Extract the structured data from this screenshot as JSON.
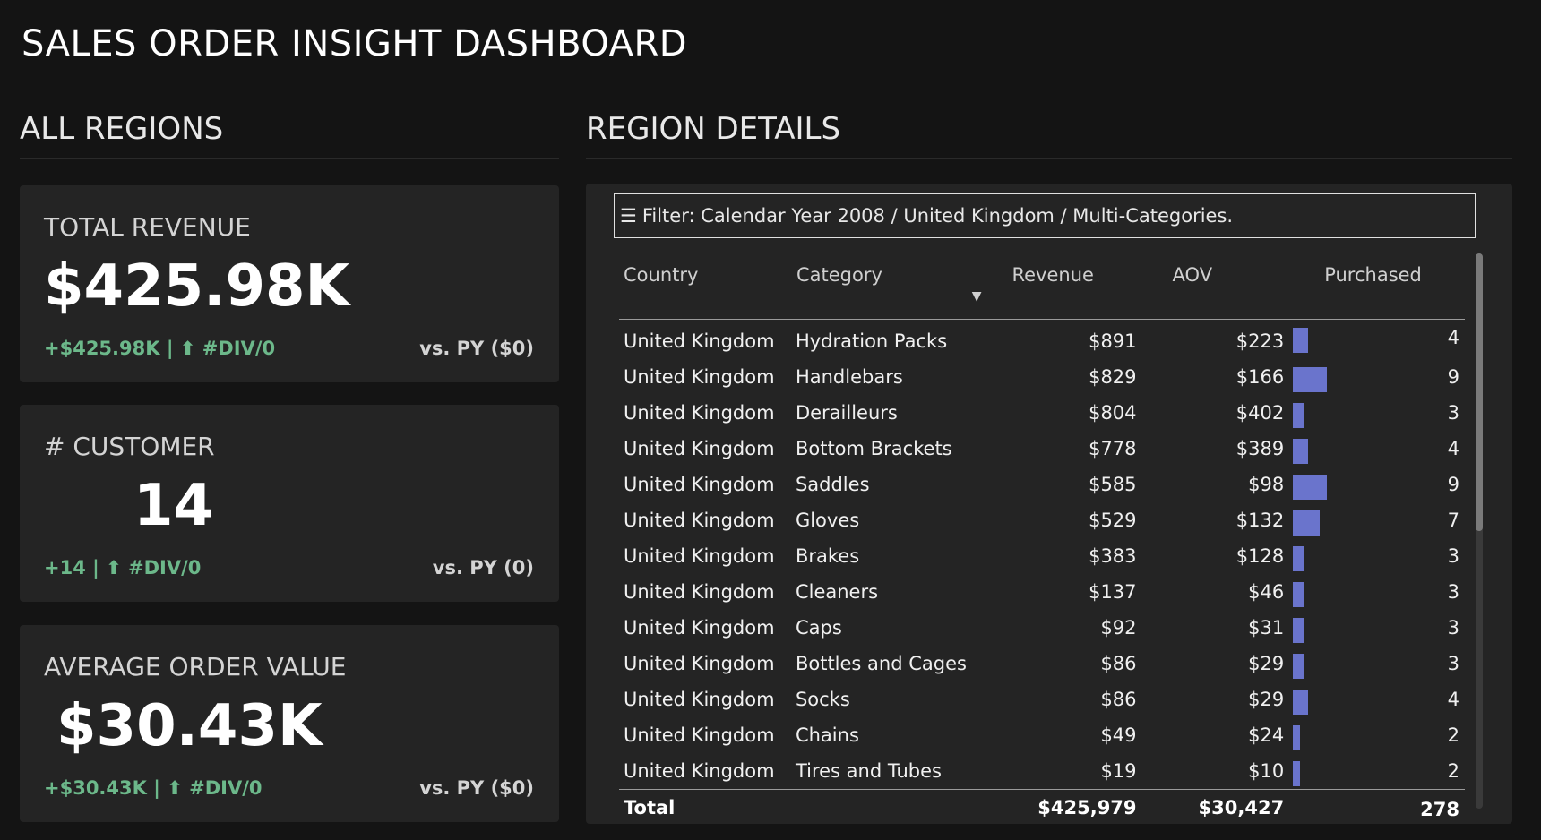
{
  "title": "SALES ORDER INSIGHT DASHBOARD",
  "left_section_title": "ALL REGIONS",
  "right_section_title": "REGION DETAILS",
  "cards": [
    {
      "label": "TOTAL REVENUE",
      "value": "$425.98K",
      "delta": "+$425.98K | ⬆ #DIV/0",
      "vs": "vs. PY ($0)"
    },
    {
      "label": "# CUSTOMER",
      "value": "14",
      "delta": "+14 | ⬆ #DIV/0",
      "vs": "vs. PY (0)"
    },
    {
      "label": "AVERAGE ORDER VALUE",
      "value": "$30.43K",
      "delta": "+$30.43K | ⬆ #DIV/0",
      "vs": "vs. PY ($0)"
    }
  ],
  "filter_icon": "hamburger-icon",
  "filter_text": "Filter: Calendar Year 2008 / United Kingdom / Multi-Categories.",
  "table": {
    "headers": {
      "country": "Country",
      "category": "Category",
      "revenue": "Revenue",
      "aov": "AOV",
      "purchased": "Purchased"
    },
    "sort_indicator": "▼",
    "rows": [
      {
        "country": "United Kingdom",
        "category": "Hydration Packs",
        "revenue": "$891",
        "aov": "$223",
        "purchased": 4
      },
      {
        "country": "United Kingdom",
        "category": "Handlebars",
        "revenue": "$829",
        "aov": "$166",
        "purchased": 9
      },
      {
        "country": "United Kingdom",
        "category": "Derailleurs",
        "revenue": "$804",
        "aov": "$402",
        "purchased": 3
      },
      {
        "country": "United Kingdom",
        "category": "Bottom Brackets",
        "revenue": "$778",
        "aov": "$389",
        "purchased": 4
      },
      {
        "country": "United Kingdom",
        "category": "Saddles",
        "revenue": "$585",
        "aov": "$98",
        "purchased": 9
      },
      {
        "country": "United Kingdom",
        "category": "Gloves",
        "revenue": "$529",
        "aov": "$132",
        "purchased": 7
      },
      {
        "country": "United Kingdom",
        "category": "Brakes",
        "revenue": "$383",
        "aov": "$128",
        "purchased": 3
      },
      {
        "country": "United Kingdom",
        "category": "Cleaners",
        "revenue": "$137",
        "aov": "$46",
        "purchased": 3
      },
      {
        "country": "United Kingdom",
        "category": "Caps",
        "revenue": "$92",
        "aov": "$31",
        "purchased": 3
      },
      {
        "country": "United Kingdom",
        "category": "Bottles and Cages",
        "revenue": "$86",
        "aov": "$29",
        "purchased": 3
      },
      {
        "country": "United Kingdom",
        "category": "Socks",
        "revenue": "$86",
        "aov": "$29",
        "purchased": 4
      },
      {
        "country": "United Kingdom",
        "category": "Chains",
        "revenue": "$49",
        "aov": "$24",
        "purchased": 2
      },
      {
        "country": "United Kingdom",
        "category": "Tires and Tubes",
        "revenue": "$19",
        "aov": "$10",
        "purchased": 2
      }
    ],
    "total": {
      "label": "Total",
      "revenue": "$425,979",
      "aov": "$30,427",
      "purchased": "278"
    }
  },
  "colors": {
    "background": "#141414",
    "card": "#242424",
    "positive": "#6cb88a",
    "bar": "#6a74cc"
  }
}
